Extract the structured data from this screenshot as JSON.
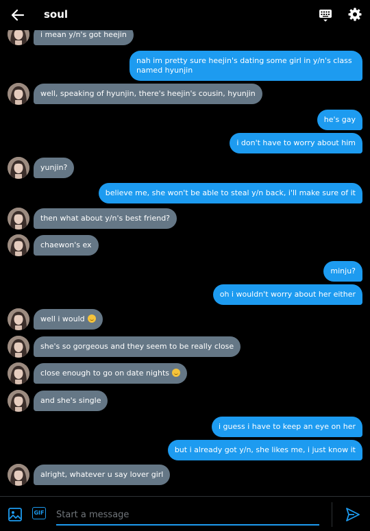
{
  "header": {
    "title": "soul",
    "icons": [
      "back-arrow-icon",
      "keyboard-icon",
      "gear-icon"
    ]
  },
  "messages": [
    {
      "side": "in",
      "text": "i mean y/n's got heejin"
    },
    {
      "side": "out",
      "text": "nah im pretty sure heejin's dating some girl in y/n's class named hyunjin"
    },
    {
      "side": "in",
      "text": "well, speaking of hyunjin, there's heejin's cousin, hyunjin"
    },
    {
      "side": "out",
      "text": "he's gay"
    },
    {
      "side": "out",
      "text": "i don't have to worry about him"
    },
    {
      "side": "in",
      "text": "yunjin?"
    },
    {
      "side": "out",
      "text": "believe me, she won't be able to steal y/n back, i'll make sure of it"
    },
    {
      "side": "in",
      "text": "then what about y/n's best friend?"
    },
    {
      "side": "in",
      "text": "chaewon's ex"
    },
    {
      "side": "out",
      "text": "minju?"
    },
    {
      "side": "out",
      "text": "oh i wouldn't worry about her either"
    },
    {
      "side": "in",
      "text": "well i would",
      "emoji": "smirk-emoji"
    },
    {
      "side": "in",
      "text": "she's so gorgeous and they seem to be really close"
    },
    {
      "side": "in",
      "text": "close enough to go on date nights",
      "emoji": "smirk-emoji"
    },
    {
      "side": "in",
      "text": "and she's single"
    },
    {
      "side": "out",
      "text": "i guess i have to keep an eye on her"
    },
    {
      "side": "out",
      "text": "but i already got y/n, she likes me, i just know it"
    },
    {
      "side": "in",
      "text": "alright, whatever u say lover girl"
    }
  ],
  "composer": {
    "placeholder": "Start a message",
    "gif_label": "GIF",
    "icons": [
      "image-icon",
      "gif-icon",
      "send-icon"
    ]
  },
  "colors": {
    "background": "#000000",
    "incoming_bubble": "#657786",
    "outgoing_bubble": "#1d9bf0",
    "accent": "#1d9bf0"
  }
}
